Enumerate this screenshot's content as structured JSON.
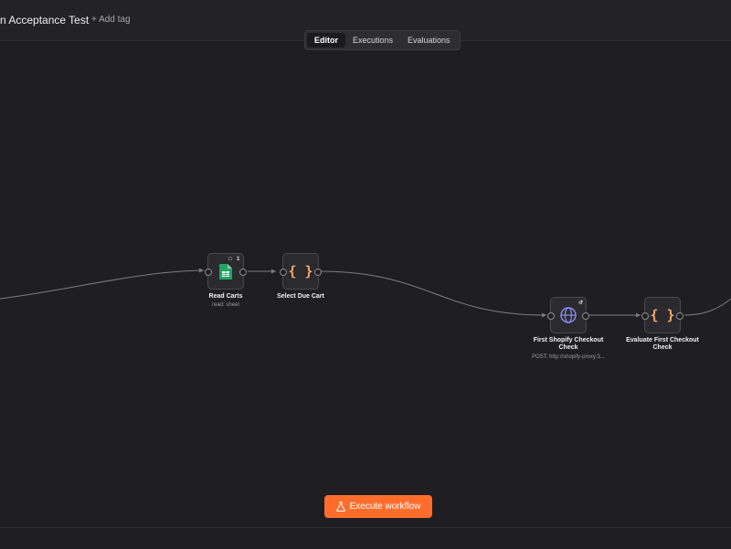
{
  "header": {
    "workflow_title": "n Acceptance Test",
    "add_tag_label": "+ Add tag"
  },
  "tabs": [
    {
      "label": "Editor",
      "active": true
    },
    {
      "label": "Executions",
      "active": false
    },
    {
      "label": "Evaluations",
      "active": false
    }
  ],
  "nodes": [
    {
      "label": "Read Carts",
      "subtitle": "read: sheet",
      "badge": "1",
      "icon": "google-sheets-icon"
    },
    {
      "label": "Select Due Cart",
      "subtitle": "",
      "icon": "code-braces-icon"
    },
    {
      "label": "First Shopify Checkout Check",
      "subtitle": "POST: http://shopify-proxy:3...",
      "icon": "globe-icon"
    },
    {
      "label": "Evaluate First Checkout Check",
      "subtitle": "",
      "icon": "code-braces-icon"
    }
  ],
  "actions": {
    "execute_label": "Execute workflow"
  },
  "colors": {
    "canvas": "#1f1e22",
    "accent": "#ff6d2d",
    "sheets_green": "#21a464",
    "code_orange": "#f0a867",
    "http_purple": "#8b8df0"
  }
}
